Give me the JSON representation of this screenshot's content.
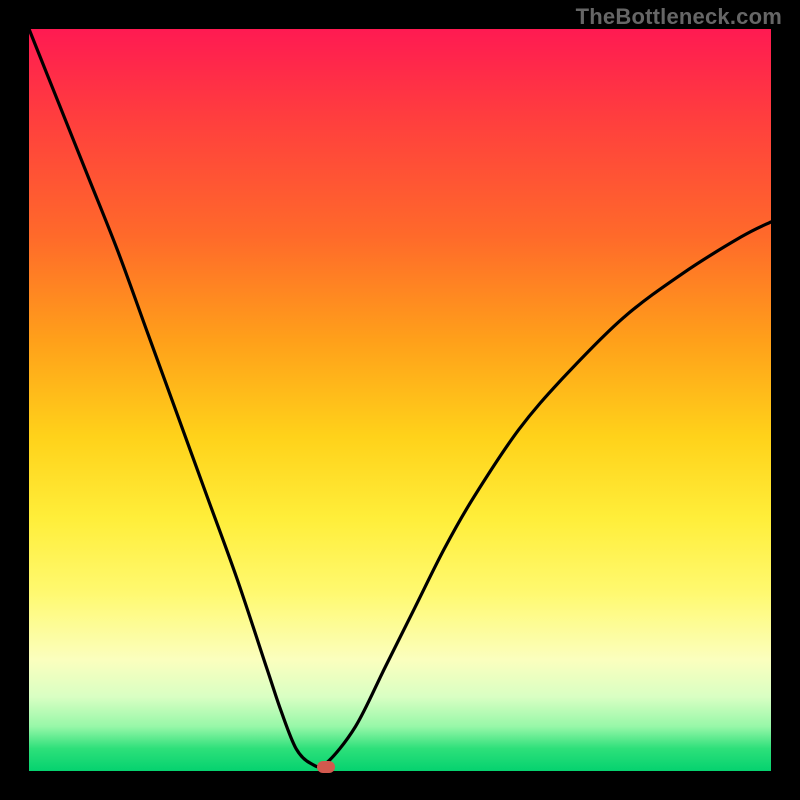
{
  "watermark": "TheBottleneck.com",
  "chart_data": {
    "type": "line",
    "title": "",
    "xlabel": "",
    "ylabel": "",
    "ylim": [
      0,
      100
    ],
    "xlim": [
      0,
      100
    ],
    "legend": false,
    "description": "Single black curve on gradient background. The curve descends steeply from top-left, reaches near-zero around x≈37, stays briefly flat, then rises with decreasing slope toward upper-right. A small rounded marker sits at the bottom near x≈40.",
    "x": [
      0,
      4,
      8,
      12,
      16,
      20,
      24,
      28,
      32,
      34,
      36,
      38,
      40,
      44,
      48,
      52,
      56,
      60,
      66,
      72,
      80,
      88,
      96,
      100
    ],
    "values": [
      100,
      90,
      80,
      70,
      59,
      48,
      37,
      26,
      14,
      8,
      3,
      1,
      1,
      6,
      14,
      22,
      30,
      37,
      46,
      53,
      61,
      67,
      72,
      74
    ],
    "marker": {
      "x": 40,
      "y": 0.6
    },
    "gradient_stops": [
      {
        "pct": 0,
        "color": "#ff1a52"
      },
      {
        "pct": 28,
        "color": "#ff6a2a"
      },
      {
        "pct": 55,
        "color": "#ffd21a"
      },
      {
        "pct": 85,
        "color": "#fbffbe"
      },
      {
        "pct": 100,
        "color": "#05d26f"
      }
    ]
  }
}
